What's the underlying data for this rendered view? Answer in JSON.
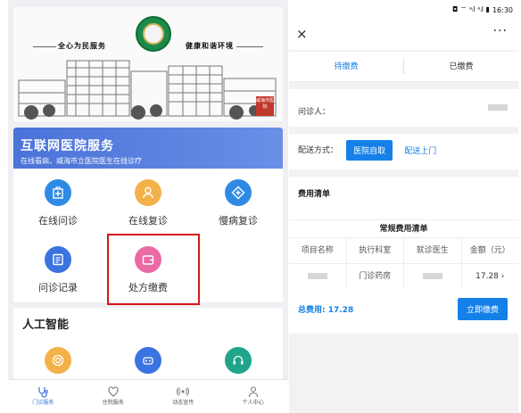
{
  "left": {
    "banner": {
      "slogan_left": "全心为民服务",
      "slogan_right": "健康和谐环境",
      "seal_text": "威海市医院"
    },
    "service": {
      "title": "互联网医院服务",
      "subtitle": "在线看病，威海市立医院医生在线诊疗",
      "items": [
        {
          "label": "在线问诊",
          "icon": "hospital-plus-icon",
          "color": "#2f8ae5"
        },
        {
          "label": "在线复诊",
          "icon": "doctor-icon",
          "color": "#f3b14a"
        },
        {
          "label": "慢病复诊",
          "icon": "cross-diamond-icon",
          "color": "#2f8ae5"
        },
        {
          "label": "问诊记录",
          "icon": "record-icon",
          "color": "#3b73e0"
        },
        {
          "label": "处方缴费",
          "icon": "wallet-icon",
          "color": "#e96aa5"
        }
      ]
    },
    "ai": {
      "title": "人工智能",
      "items": [
        {
          "icon": "target-icon",
          "color": "#f3b14a"
        },
        {
          "icon": "robot-icon",
          "color": "#3b73e0"
        },
        {
          "icon": "headset-icon",
          "color": "#21a58a"
        }
      ]
    },
    "tabbar": [
      {
        "label": "门诊服务",
        "icon": "stethoscope-icon",
        "active": true
      },
      {
        "label": "住院服务",
        "icon": "heart-icon",
        "active": false
      },
      {
        "label": "动态宣传",
        "icon": "broadcast-icon",
        "active": false
      },
      {
        "label": "个人中心",
        "icon": "person-icon",
        "active": false
      }
    ]
  },
  "right": {
    "status": {
      "time": "16:30",
      "icons": "◘ ⌔ ᵃᵢl ᵃᵢl ▮"
    },
    "nav": {
      "close": "×",
      "more": "···"
    },
    "tabs": {
      "pending": "待缴费",
      "paid": "已缴费"
    },
    "patient_label": "问诊人：",
    "delivery": {
      "label": "配送方式：",
      "option_active": "医院自取",
      "option_other": "配送上门"
    },
    "fee_list_title": "费用清单",
    "table": {
      "caption": "常规费用清单",
      "headers": [
        "项目名称",
        "执行科室",
        "就诊医生",
        "金额（元）"
      ],
      "row": {
        "dept": "门诊药房",
        "amount": "17.28"
      }
    },
    "total_label": "总费用:",
    "total_value": "17.28",
    "pay_button": "立即缴费",
    "colors": {
      "accent": "#1580e8"
    }
  }
}
